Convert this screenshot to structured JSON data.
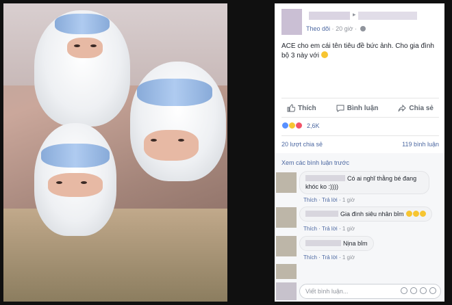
{
  "post": {
    "meta_follow": "Theo dõi",
    "meta_dot": "·",
    "meta_time": "20 giờ",
    "meta_sep": "·",
    "text": "ACE cho em cái tên tiêu đề bức ảnh. Cho gia đình bộ 3 này với"
  },
  "actions": {
    "like": "Thích",
    "comment": "Bình luận",
    "share": "Chia sẻ"
  },
  "reactions": {
    "count": "2,6K",
    "shares": "20 lượt chia sẻ",
    "comments": "119 bình luận"
  },
  "comments_section": {
    "view_previous": "Xem các bình luận trước",
    "items": [
      {
        "text": "Có ai nghĩ thằng bé đang khóc ko :))))",
        "like": "Thích",
        "reply": "Trả lời",
        "time": "1 giờ"
      },
      {
        "text": "Gia đình siêu nhân bỉm",
        "like": "Thích",
        "reply": "Trả lời",
        "time": "1 giờ"
      },
      {
        "text": "Nịna bỉm",
        "like": "Thích",
        "reply": "Trả lời",
        "time": "1 giờ"
      }
    ],
    "write_placeholder": "Viết bình luận..."
  },
  "colors": {
    "link": "#4b67a1",
    "muted": "#90949c",
    "like_blue": "#5890ff",
    "haha_yellow": "#f7c531",
    "love_red": "#f25268"
  }
}
